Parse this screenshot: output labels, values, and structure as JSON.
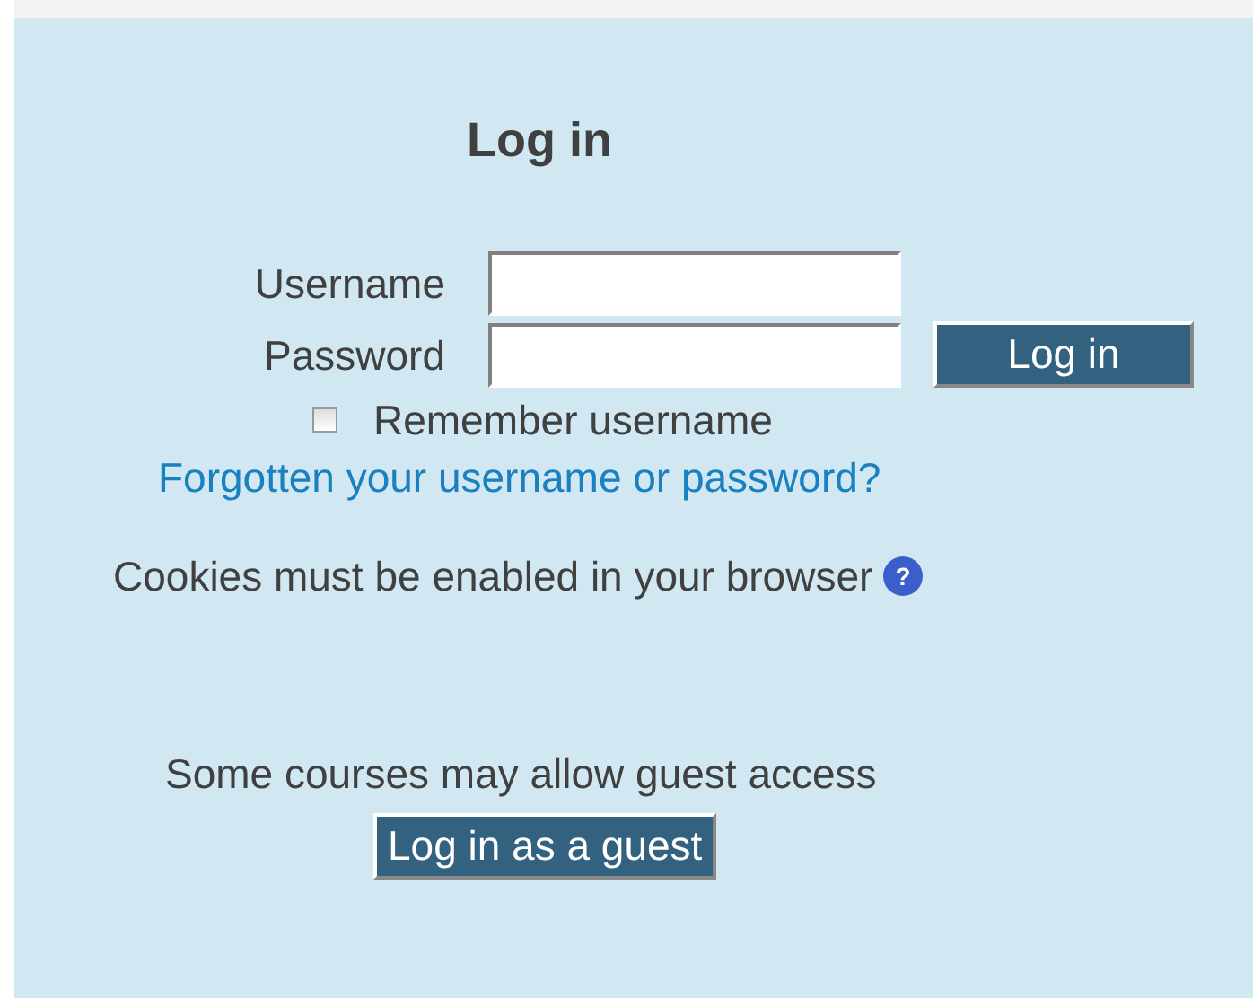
{
  "title": "Log in",
  "fields": [
    {
      "label": "Username"
    },
    {
      "label": "Password"
    }
  ],
  "login_button": "Log in",
  "remember": {
    "label": "Remember username",
    "checked": false
  },
  "forgot_link": "Forgotten your username or password?",
  "cookies_note": "Cookies must be enabled in your browser",
  "help_icon": "?",
  "guest_note": "Some courses may allow guest access",
  "guest_button": "Log in as a guest"
}
